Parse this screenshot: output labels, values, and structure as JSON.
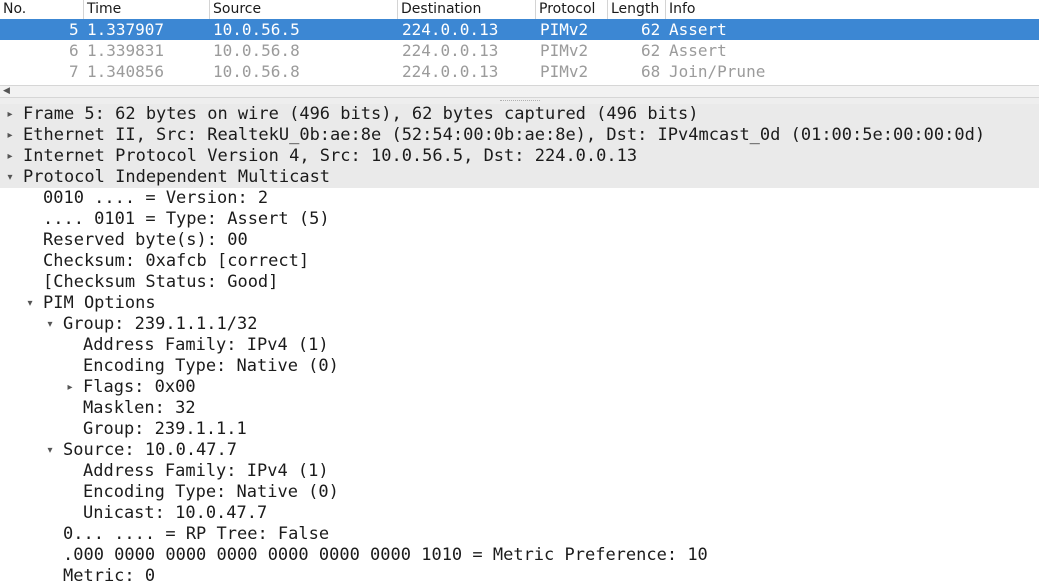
{
  "columns": [
    "No.",
    "Time",
    "Source",
    "Destination",
    "Protocol",
    "Length",
    "Info"
  ],
  "packets": [
    {
      "no": "5",
      "time": "1.337907",
      "source": "10.0.56.5",
      "destination": "224.0.0.13",
      "protocol": "PIMv2",
      "length": "62",
      "info": "Assert"
    },
    {
      "no": "6",
      "time": "1.339831",
      "source": "10.0.56.8",
      "destination": "224.0.0.13",
      "protocol": "PIMv2",
      "length": "62",
      "info": "Assert"
    },
    {
      "no": "7",
      "time": "1.340856",
      "source": "10.0.56.8",
      "destination": "224.0.0.13",
      "protocol": "PIMv2",
      "length": "68",
      "info": "Join/Prune"
    }
  ],
  "selected_packet_index": 0,
  "details": [
    {
      "text": "Frame 5: 62 bytes on wire (496 bits), 62 bytes captured (496 bits)",
      "level": 0,
      "state": "collapsed",
      "top": true
    },
    {
      "text": "Ethernet II, Src: RealtekU_0b:ae:8e (52:54:00:0b:ae:8e), Dst: IPv4mcast_0d (01:00:5e:00:00:0d)",
      "level": 0,
      "state": "collapsed",
      "top": true
    },
    {
      "text": "Internet Protocol Version 4, Src: 10.0.56.5, Dst: 224.0.0.13",
      "level": 0,
      "state": "collapsed",
      "top": true
    },
    {
      "text": "Protocol Independent Multicast",
      "level": 0,
      "state": "expanded",
      "top": true
    },
    {
      "text": "0010 .... = Version: 2",
      "level": 1,
      "state": "leaf"
    },
    {
      "text": ".... 0101 = Type: Assert (5)",
      "level": 1,
      "state": "leaf"
    },
    {
      "text": "Reserved byte(s): 00",
      "level": 1,
      "state": "leaf"
    },
    {
      "text": "Checksum: 0xafcb [correct]",
      "level": 1,
      "state": "leaf"
    },
    {
      "text": "[Checksum Status: Good]",
      "level": 1,
      "state": "leaf"
    },
    {
      "text": "PIM Options",
      "level": 1,
      "state": "expanded"
    },
    {
      "text": "Group: 239.1.1.1/32",
      "level": 2,
      "state": "expanded"
    },
    {
      "text": "Address Family: IPv4 (1)",
      "level": 3,
      "state": "leaf"
    },
    {
      "text": "Encoding Type: Native (0)",
      "level": 3,
      "state": "leaf"
    },
    {
      "text": "Flags: 0x00",
      "level": 3,
      "state": "collapsed"
    },
    {
      "text": "Masklen: 32",
      "level": 3,
      "state": "leaf"
    },
    {
      "text": "Group: 239.1.1.1",
      "level": 3,
      "state": "leaf"
    },
    {
      "text": "Source: 10.0.47.7",
      "level": 2,
      "state": "expanded"
    },
    {
      "text": "Address Family: IPv4 (1)",
      "level": 3,
      "state": "leaf"
    },
    {
      "text": "Encoding Type: Native (0)",
      "level": 3,
      "state": "leaf"
    },
    {
      "text": "Unicast: 10.0.47.7",
      "level": 3,
      "state": "leaf"
    },
    {
      "text": "0... .... = RP Tree: False",
      "level": 2,
      "state": "leaf"
    },
    {
      "text": ".000 0000 0000 0000 0000 0000 0000 1010 = Metric Preference: 10",
      "level": 2,
      "state": "leaf"
    },
    {
      "text": "Metric: 0",
      "level": 2,
      "state": "leaf"
    }
  ],
  "icons": {
    "collapsed": "triangle-right-icon",
    "expanded": "triangle-down-icon",
    "scroll_left": "arrow-left-icon"
  },
  "colors": {
    "selection": "#3c87d3",
    "dim_text": "#9b9b9b",
    "top_level_bg": "#eaeaea"
  }
}
